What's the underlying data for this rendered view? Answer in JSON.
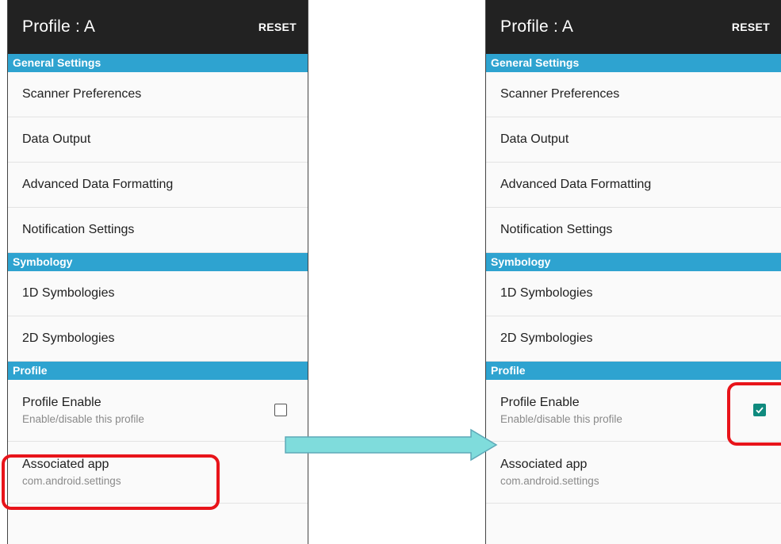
{
  "left": {
    "title": "Profile : A",
    "reset_label": "RESET",
    "sections": {
      "general": "General Settings",
      "symbology": "Symbology",
      "profile": "Profile"
    },
    "general_items": [
      "Scanner Preferences",
      "Data Output",
      "Advanced Data Formatting",
      "Notification Settings"
    ],
    "symbology_items": [
      "1D Symbologies",
      "2D Symbologies"
    ],
    "profile_enable": {
      "label": "Profile Enable",
      "sub": "Enable/disable this profile",
      "checked": false
    },
    "associated_app": {
      "label": "Associated app",
      "sub": "com.android.settings"
    }
  },
  "right": {
    "title": "Profile : A",
    "reset_label": "RESET",
    "sections": {
      "general": "General Settings",
      "symbology": "Symbology",
      "profile": "Profile"
    },
    "general_items": [
      "Scanner Preferences",
      "Data Output",
      "Advanced Data Formatting",
      "Notification Settings"
    ],
    "symbology_items": [
      "1D Symbologies",
      "2D Symbologies"
    ],
    "profile_enable": {
      "label": "Profile Enable",
      "sub": "Enable/disable this profile",
      "checked": true
    },
    "associated_app": {
      "label": "Associated app",
      "sub": "com.android.settings"
    }
  },
  "colors": {
    "appbar": "#222222",
    "section": "#2ea3d0",
    "checkbox_checked": "#0f8a7e",
    "highlight": "#e8141a",
    "arrow": "#7fdcdc"
  }
}
